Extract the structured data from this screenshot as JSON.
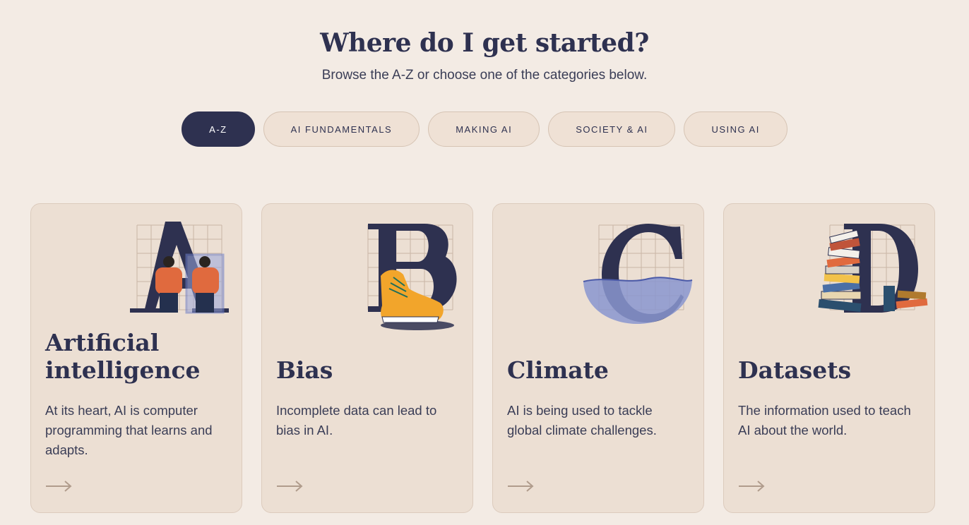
{
  "header": {
    "title": "Where do I get started?",
    "subtitle": "Browse the A-Z or choose one of the categories below."
  },
  "tabs": [
    {
      "label": "A-Z",
      "active": true
    },
    {
      "label": "AI FUNDAMENTALS",
      "active": false
    },
    {
      "label": "MAKING AI",
      "active": false
    },
    {
      "label": "SOCIETY & AI",
      "active": false
    },
    {
      "label": "USING AI",
      "active": false
    }
  ],
  "cards": [
    {
      "letter": "A",
      "title": "Artificial intelligence",
      "description": "At its heart, AI is computer programming that learns and adapts.",
      "illustration": "people-mirror-illustration"
    },
    {
      "letter": "B",
      "title": "Bias",
      "description": "Incomplete data can lead to bias in AI.",
      "illustration": "sneaker-illustration"
    },
    {
      "letter": "C",
      "title": "Climate",
      "description": "AI is being used to tackle global climate challenges.",
      "illustration": "water-bowl-illustration"
    },
    {
      "letter": "D",
      "title": "Datasets",
      "description": "The information used to teach AI about the world.",
      "illustration": "book-stack-illustration"
    }
  ],
  "colors": {
    "background": "#f3ebe4",
    "card": "#ecdfd3",
    "navy": "#2e3150",
    "orange": "#e06a3e",
    "yellow": "#f2a52b",
    "water": "#8a96cf"
  }
}
